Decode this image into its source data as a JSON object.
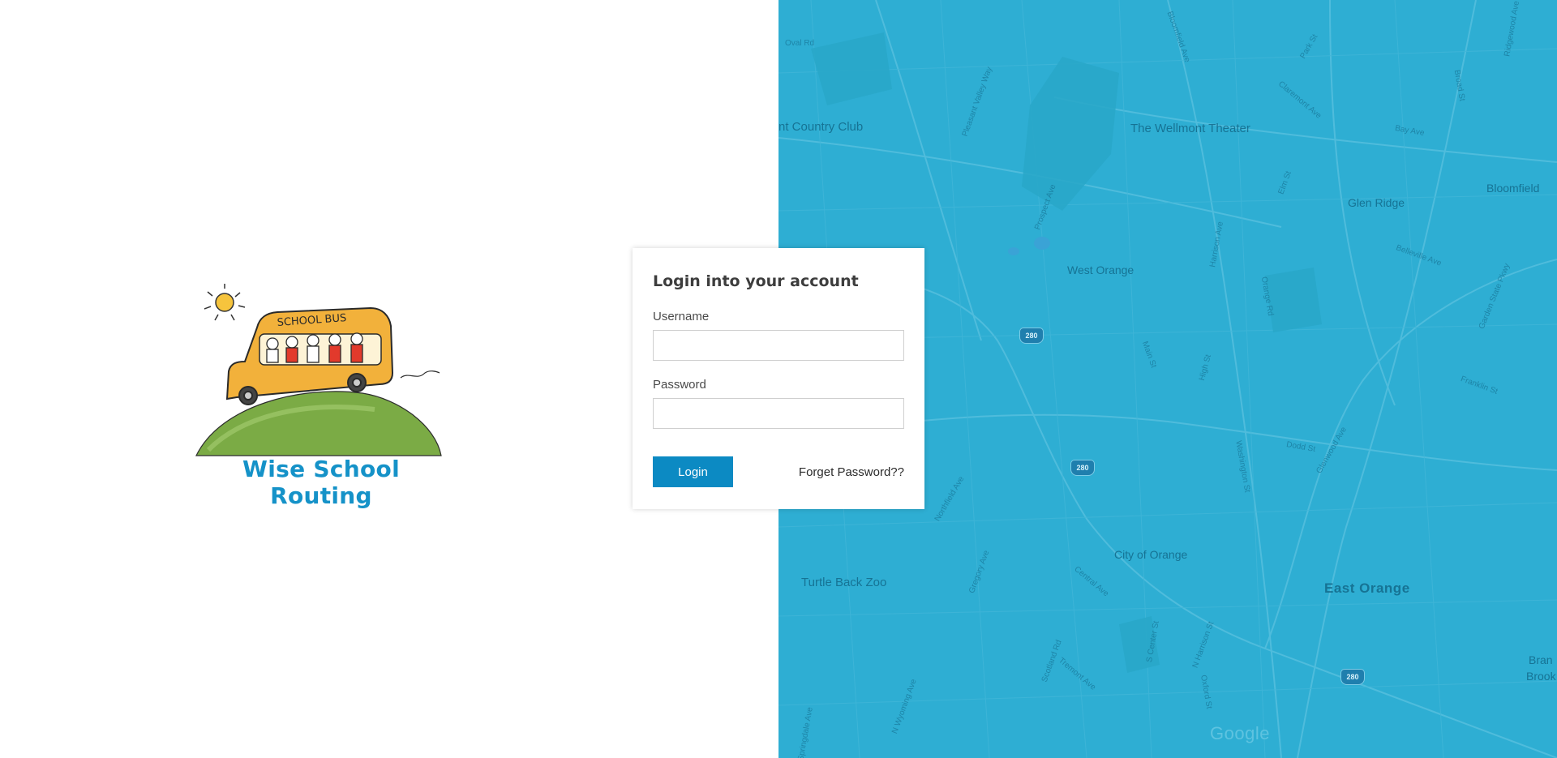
{
  "brand": {
    "name": "Wise School Routing",
    "bus_sign": "SCHOOL BUS",
    "colors": {
      "brand_blue": "#1592c8",
      "bus_yellow": "#f2b13b",
      "grass_green": "#7bab45"
    }
  },
  "login": {
    "title": "Login into your account",
    "username_label": "Username",
    "username_value": "",
    "password_label": "Password",
    "password_value": "",
    "submit_label": "Login",
    "forgot_label": "Forget Password??",
    "button_color": "#0c8ac3"
  },
  "map": {
    "background_color": "#2eaed3",
    "places": [
      "nt Country Club",
      "The Wellmont Theater",
      "Bloomfield",
      "Glen Ridge",
      "West Orange",
      "City of Orange",
      "Turtle Back Zoo",
      "East Orange",
      "Bran",
      "Brook"
    ],
    "streets": [
      "Oval Rd",
      "Pleasant Valley Way",
      "Bloomfield Ave",
      "Ridgewood Ave",
      "Claremont Ave",
      "Bay Ave",
      "Broad St",
      "Park St",
      "Elm St",
      "Prospect Ave",
      "Harrison Ave",
      "Belleville Ave",
      "Garden State Pkwy",
      "Main St",
      "High St",
      "Orange Rd",
      "Franklin St",
      "Dodd St",
      "Glenwood Ave",
      "Washington St",
      "Northfield Ave",
      "Central Ave",
      "Gregory Ave",
      "Scotland Rd",
      "Tremont Ave",
      "S Center St",
      "N Harrison St",
      "Oxford St",
      "N Wyoming Ave",
      "Springdale Ave"
    ],
    "highway_shield": "280",
    "attribution": "Google"
  }
}
